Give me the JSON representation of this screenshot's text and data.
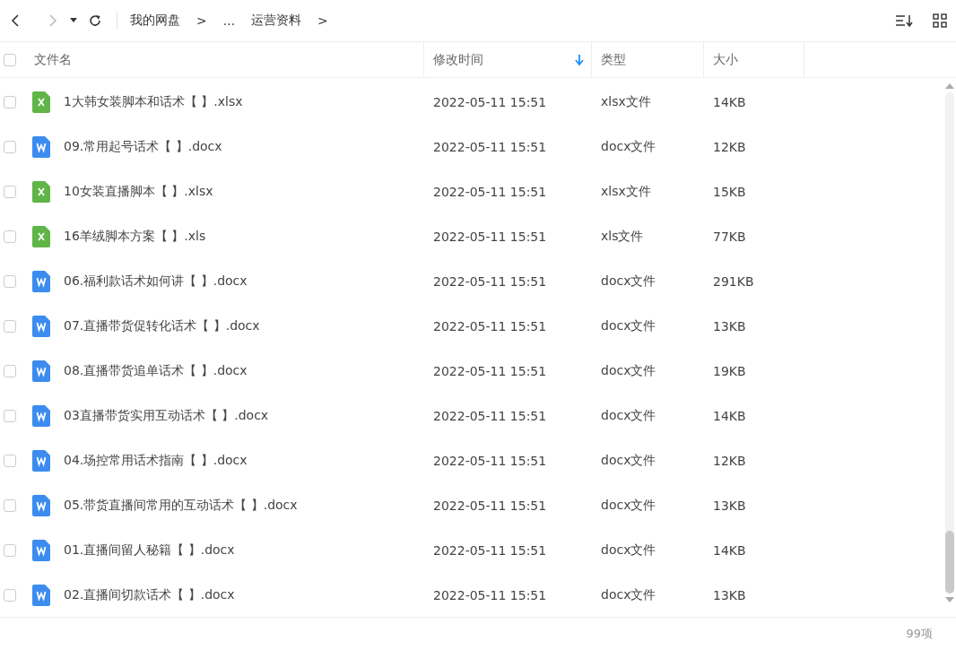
{
  "breadcrumb": [
    {
      "label": "我的网盘"
    },
    {
      "label": ">"
    },
    {
      "label": "..."
    },
    {
      "label": "运营资料"
    },
    {
      "label": ">"
    }
  ],
  "table": {
    "all_checked": false,
    "columns": [
      {
        "label": "文件名",
        "sorted": false
      },
      {
        "label": "修改时间",
        "sorted": true
      },
      {
        "label": "类型",
        "sorted": false
      },
      {
        "label": "大小",
        "sorted": false
      }
    ],
    "rows": [
      {
        "kind": "xlsx",
        "name": "1大韩女装脚本和话术【 】.xlsx",
        "modified": "2022-05-11 15:51",
        "type": "xlsx文件",
        "size": "14KB",
        "checked": false
      },
      {
        "kind": "docx",
        "name": "09.常用起号话术【 】.docx",
        "modified": "2022-05-11 15:51",
        "type": "docx文件",
        "size": "12KB",
        "checked": false
      },
      {
        "kind": "xlsx",
        "name": "10女装直播脚本【 】.xlsx",
        "modified": "2022-05-11 15:51",
        "type": "xlsx文件",
        "size": "15KB",
        "checked": false
      },
      {
        "kind": "xlsx",
        "name": "16羊绒脚本方案【 】.xls",
        "modified": "2022-05-11 15:51",
        "type": "xls文件",
        "size": "77KB",
        "checked": false
      },
      {
        "kind": "docx",
        "name": "06.福利款话术如何讲【 】.docx",
        "modified": "2022-05-11 15:51",
        "type": "docx文件",
        "size": "291KB",
        "checked": false
      },
      {
        "kind": "docx",
        "name": "07.直播带货促转化话术【 】.docx",
        "modified": "2022-05-11 15:51",
        "type": "docx文件",
        "size": "13KB",
        "checked": false
      },
      {
        "kind": "docx",
        "name": "08.直播带货追单话术【 】.docx",
        "modified": "2022-05-11 15:51",
        "type": "docx文件",
        "size": "19KB",
        "checked": false
      },
      {
        "kind": "docx",
        "name": "03直播带货实用互动话术【 】.docx",
        "modified": "2022-05-11 15:51",
        "type": "docx文件",
        "size": "14KB",
        "checked": false
      },
      {
        "kind": "docx",
        "name": "04.场控常用话术指南【 】.docx",
        "modified": "2022-05-11 15:51",
        "type": "docx文件",
        "size": "12KB",
        "checked": false
      },
      {
        "kind": "docx",
        "name": "05.带货直播间常用的互动话术【 】.docx",
        "modified": "2022-05-11 15:51",
        "type": "docx文件",
        "size": "13KB",
        "checked": false
      },
      {
        "kind": "docx",
        "name": "01.直播间留人秘籍【 】.docx",
        "modified": "2022-05-11 15:51",
        "type": "docx文件",
        "size": "14KB",
        "checked": false
      },
      {
        "kind": "docx",
        "name": "02.直播间切款话术【 】.docx",
        "modified": "2022-05-11 15:51",
        "type": "docx文件",
        "size": "13KB",
        "checked": false
      }
    ]
  },
  "status_bar": {
    "count": "99项"
  }
}
